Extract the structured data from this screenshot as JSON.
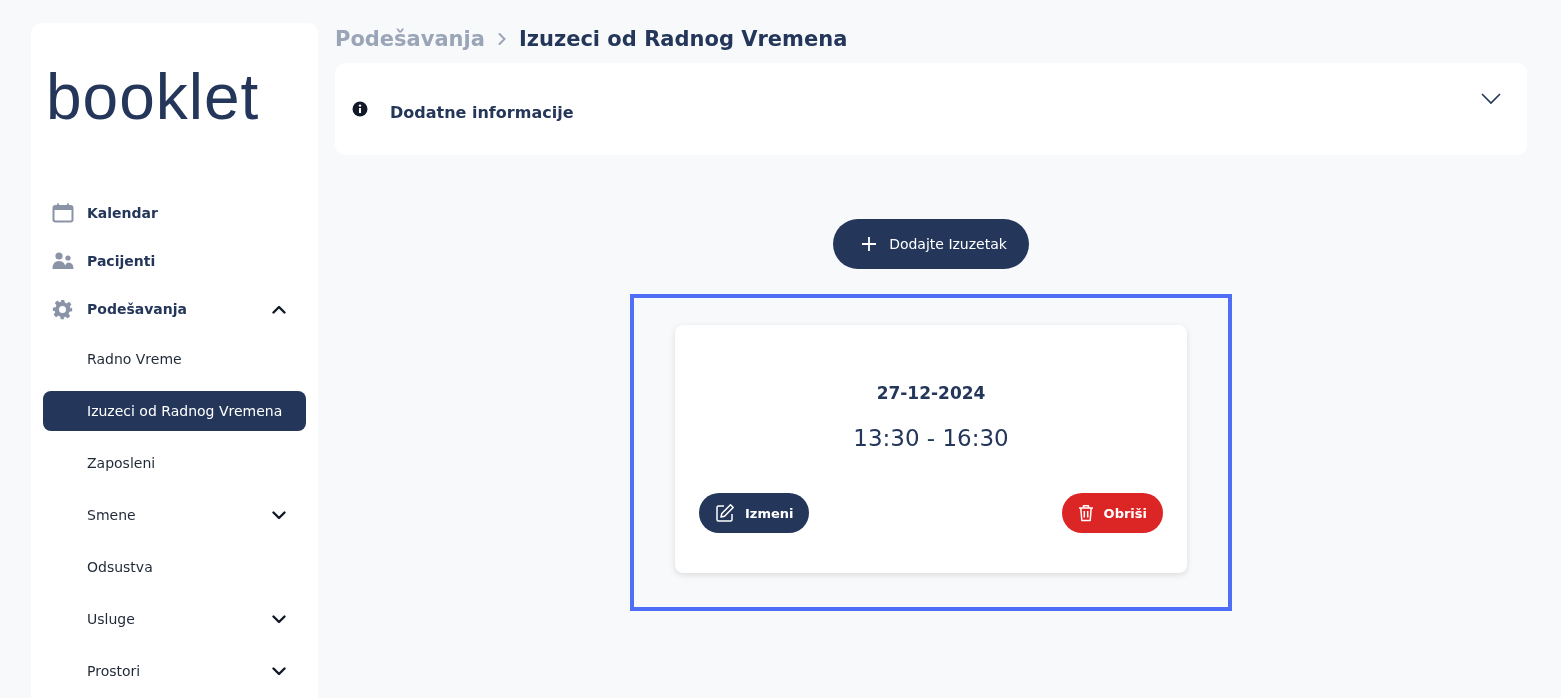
{
  "logo": "booklet",
  "sidebar": {
    "items": [
      {
        "label": "Kalendar",
        "selected": false
      },
      {
        "label": "Pacijenti",
        "selected": false
      },
      {
        "label": "Podešavanja",
        "selected": false,
        "expanded": true,
        "children": [
          {
            "label": "Radno Vreme",
            "selected": false
          },
          {
            "label": "Izuzeci od Radnog Vremena",
            "selected": true
          },
          {
            "label": "Zaposleni",
            "selected": false
          },
          {
            "label": "Smene",
            "selected": false,
            "expanded": false
          },
          {
            "label": "Odsustva",
            "selected": false
          },
          {
            "label": "Usluge",
            "selected": false,
            "expanded": false
          },
          {
            "label": "Prostori",
            "selected": false,
            "expanded": false
          }
        ]
      }
    ]
  },
  "breadcrumb": [
    "Podešavanja",
    "Izuzeci od Radnog Vremena"
  ],
  "info_panel": {
    "title": "Dodatne informacije",
    "expanded": false
  },
  "add_button": "Dodajte Izuzetak",
  "exceptions": [
    {
      "date": "27-12-2024",
      "time": "13:30 - 16:30",
      "highlighted": true,
      "edit_button": "Izmeni",
      "delete_button": "Obriši"
    }
  ]
}
